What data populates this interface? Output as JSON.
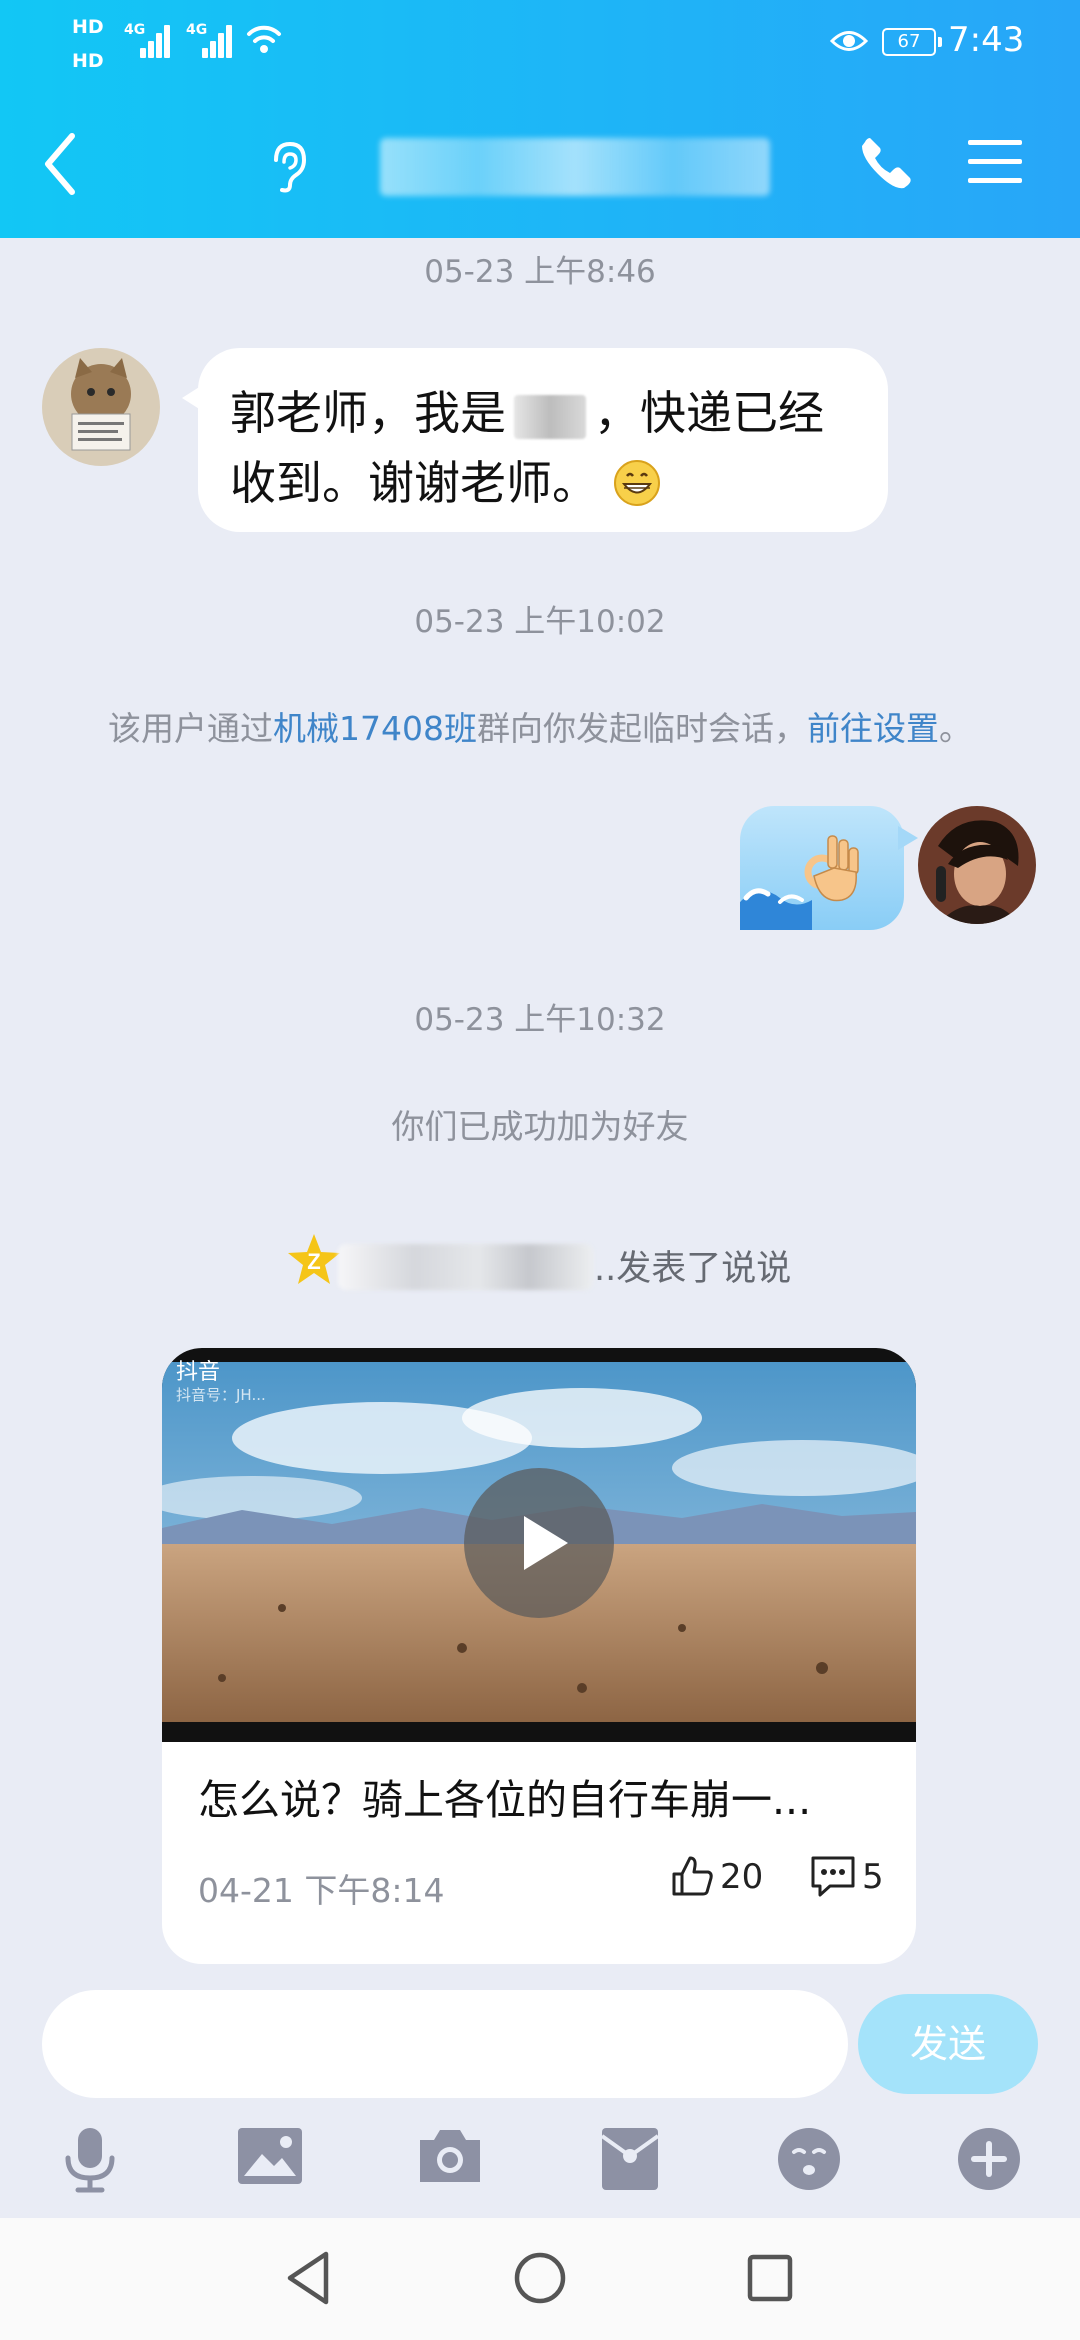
{
  "status_bar": {
    "hd_1": "HD",
    "hd_2": "HD",
    "network_1": "4G",
    "network_2": "4G",
    "battery": "67",
    "time": "7:43"
  },
  "header": {
    "icons": [
      "back-icon",
      "ear-icon",
      "phone-icon",
      "menu-icon"
    ]
  },
  "messages": {
    "ts1": "05-23 上午8:46",
    "incoming_1_part1": "郭老师，我是",
    "incoming_1_part2": "，快递已经收到。谢谢老师。",
    "ts2": "05-23 上午10:02",
    "sys1_pre": "该用户通过",
    "sys1_link": "机械17408班",
    "sys1_mid": "群向你发起临时会话，",
    "sys1_action": "前往设置",
    "sys1_end": "。",
    "ts3": "05-23 上午10:32",
    "sys2": "你们已成功加为好友",
    "qzone_text": "..发表了说说"
  },
  "shared_post": {
    "tiktok_label": "抖音",
    "tiktok_id": "抖音号：JH...",
    "title": "怎么说？骑上各位的自行车崩一...",
    "date": "04-21 下午8:14",
    "likes": "20",
    "comments": "5"
  },
  "composer": {
    "input_value": "",
    "send_label": "发送"
  },
  "colors": {
    "header_start": "#12c7f5",
    "header_end": "#28a6f8",
    "background": "#e9ecf5",
    "link": "#3f85c9",
    "send_button": "#a4e3fa",
    "toolbar_icon": "#8d91a4"
  },
  "toolbar_icons": [
    "microphone-icon",
    "image-icon",
    "camera-icon",
    "red-packet-icon",
    "emoji-icon",
    "plus-icon"
  ],
  "navigation_icons": [
    "back-triangle-icon",
    "home-circle-icon",
    "recents-square-icon"
  ]
}
